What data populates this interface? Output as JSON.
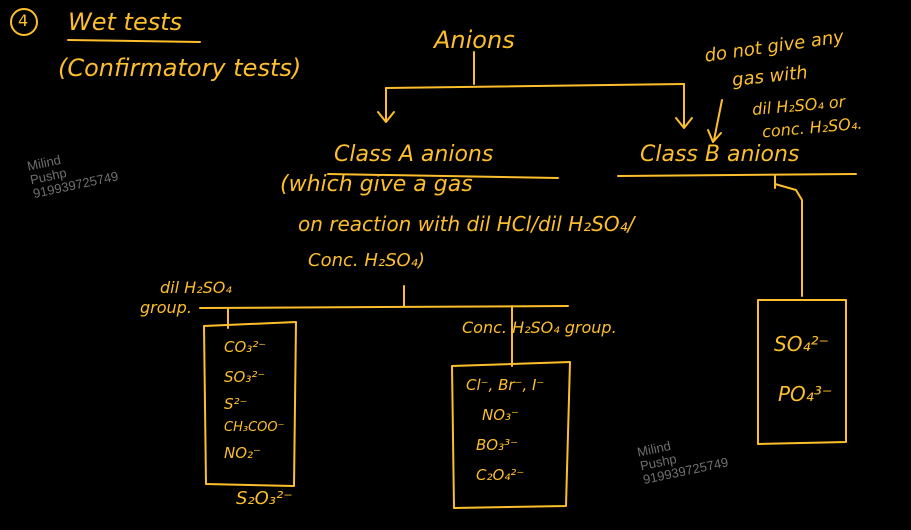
{
  "heading": {
    "number": "4",
    "title": "Wet tests",
    "subtitle": "(Confirmatory tests)"
  },
  "root": "Anions",
  "class_a": {
    "title": "Class A anions",
    "desc1": "(which give a gas",
    "desc2": "on reaction with dil HCl/dil H₂SO₄/",
    "desc3": "Conc. H₂SO₄)"
  },
  "class_b": {
    "title": "Class B anions",
    "note1": "do not give any",
    "note2": "gas with",
    "note3": "dil H₂SO₄ or",
    "note4": "conc. H₂SO₄."
  },
  "dil_group": {
    "label1": "dil H₂SO₄",
    "label2": "group.",
    "ions": [
      "CO₃²⁻",
      "SO₃²⁻",
      "S²⁻",
      "CH₃COO⁻",
      "NO₂⁻"
    ],
    "extra": "S₂O₃²⁻"
  },
  "conc_group": {
    "label": "Conc. H₂SO₄ group.",
    "ions": [
      "Cl⁻, Br⁻, I⁻",
      "NO₃⁻",
      "BO₃³⁻",
      "C₂O₄²⁻"
    ]
  },
  "class_b_group": {
    "ions": [
      "SO₄²⁻",
      "PO₄³⁻"
    ]
  },
  "watermark": {
    "line1": "Milind",
    "line2": "Pushp",
    "line3": "919939725749"
  },
  "colors": {
    "ink": "#FDBE2C",
    "background": "#000000",
    "watermark": "#6f6f6f"
  }
}
